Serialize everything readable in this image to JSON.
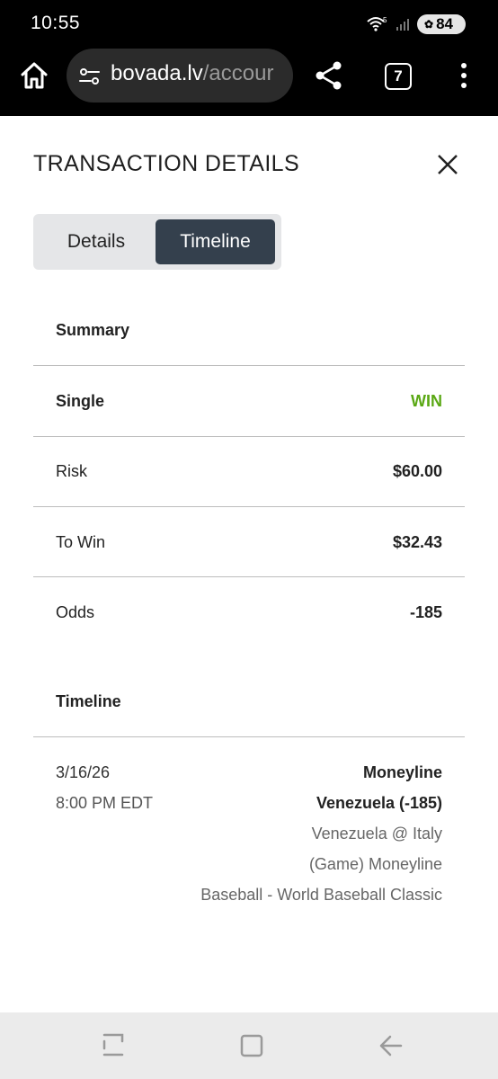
{
  "status": {
    "time": "10:55",
    "wifi_badge": "5",
    "battery": "84"
  },
  "browser": {
    "url_host": "bovada.lv",
    "url_path": "/accour",
    "tab_count": "7"
  },
  "modal": {
    "title": "TRANSACTION DETAILS",
    "tabs": [
      {
        "label": "Details",
        "active": false
      },
      {
        "label": "Timeline",
        "active": true
      }
    ]
  },
  "summary": {
    "heading": "Summary",
    "bet_type": "Single",
    "result": "WIN",
    "rows": [
      {
        "label": "Risk",
        "value": "$60.00"
      },
      {
        "label": "To Win",
        "value": "$32.43"
      },
      {
        "label": "Odds",
        "value": "-185"
      }
    ]
  },
  "timeline": {
    "heading": "Timeline",
    "entry": {
      "date": "3/16/26",
      "time": "8:00 PM EDT",
      "market": "Moneyline",
      "selection": "Venezuela (-185)",
      "event": "Venezuela @ Italy",
      "market_detail": "(Game) Moneyline",
      "league": "Baseball - World Baseball Classic"
    }
  },
  "colors": {
    "win": "#5aa814",
    "active_tab_bg": "#34404d",
    "segment_bg": "#e5e6e8"
  }
}
